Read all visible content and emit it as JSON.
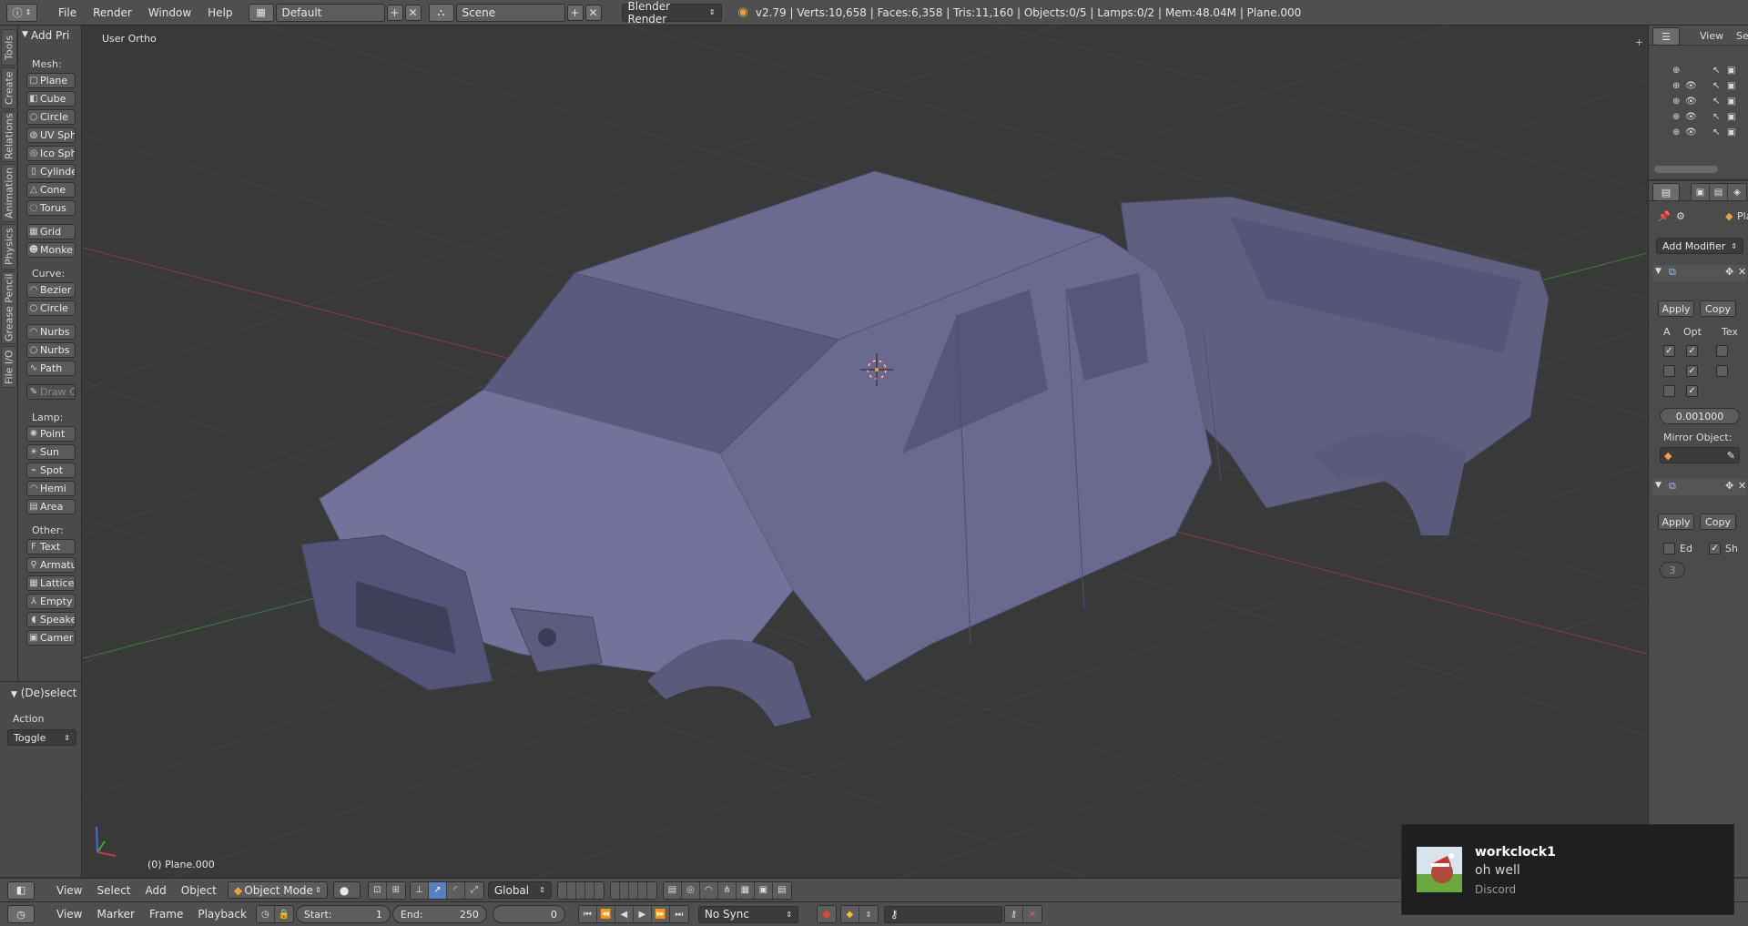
{
  "topbar": {
    "menus": [
      "File",
      "Render",
      "Window",
      "Help"
    ],
    "screen_layout": "Default",
    "scene": "Scene",
    "render_engine": "Blender Render",
    "stats": "v2.79 | Verts:10,658 | Faces:6,358 | Tris:11,160 | Objects:0/5 | Lamps:0/2 | Mem:48.04M | Plane.000"
  },
  "vtabs": [
    "Tools",
    "Create",
    "Relations",
    "Animation",
    "Physics",
    "Grease Pencil",
    "File I/O"
  ],
  "toolshelf": {
    "header": "Add Pri",
    "mesh_label": "Mesh:",
    "mesh": [
      "Plane",
      "Cube",
      "Circle",
      "UV Sph",
      "Ico Sph",
      "Cylinde",
      "Cone",
      "Torus"
    ],
    "mesh2": [
      "Grid",
      "Monke"
    ],
    "curve_label": "Curve:",
    "curve": [
      "Bezier",
      "Circle"
    ],
    "nurbs": [
      "Nurbs",
      "Nurbs",
      "Path"
    ],
    "draw": "Draw C",
    "lamp_label": "Lamp:",
    "lamp": [
      "Point",
      "Sun",
      "Spot",
      "Hemi",
      "Area"
    ],
    "other_label": "Other:",
    "other": [
      "Text",
      "Armatu",
      "Lattice",
      "Empty",
      "Speake",
      "Camer"
    ]
  },
  "operator_panel": {
    "header": "(De)select",
    "action_label": "Action",
    "action_value": "Toggle"
  },
  "viewport": {
    "view_label": "User Ortho",
    "object_label": "(0) Plane.000"
  },
  "outliner": {
    "view_menu": "View",
    "search_menu": "Se"
  },
  "properties": {
    "object_name": "Pla",
    "add_modifier": "Add Modifier",
    "apply": "Apply",
    "copy": "Copy",
    "axis_headers": [
      "A",
      "Opt",
      "Tex"
    ],
    "merge_value": "0.001000",
    "mirror_object_label": "Mirror Object:",
    "apply2": "Apply",
    "copy2": "Copy",
    "check_ed": "Ed",
    "check_sh": "Sh",
    "subsurf_value": "3"
  },
  "viewport_header": {
    "menus": [
      "View",
      "Select",
      "Add",
      "Object"
    ],
    "mode": "Object Mode",
    "orientation": "Global"
  },
  "timeline": {
    "menus": [
      "View",
      "Marker",
      "Frame",
      "Playback"
    ],
    "start_label": "Start:",
    "start_value": "1",
    "end_label": "End:",
    "end_value": "250",
    "current_frame": "0",
    "sync": "No Sync"
  },
  "toast": {
    "title": "workclock1",
    "body": "oh well",
    "app": "Discord"
  },
  "colors": {
    "model": "#6b6b8f",
    "accent_blue": "#5680c2",
    "x_axis": "#a83232",
    "y_axis": "#3f8f3f"
  }
}
